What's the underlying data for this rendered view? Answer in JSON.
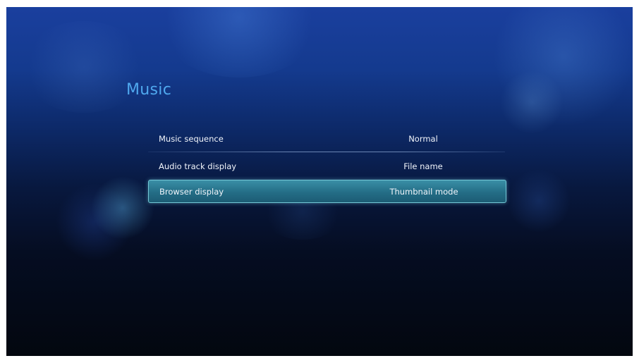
{
  "page": {
    "title": "Music"
  },
  "settings": [
    {
      "label": "Music sequence",
      "value": "Normal"
    },
    {
      "label": "Audio track display",
      "value": "File name"
    },
    {
      "label": "Browser display",
      "value": "Thumbnail mode"
    }
  ],
  "selected_index": 2,
  "colors": {
    "title": "#4fa8ee",
    "highlight": "#2f8099",
    "highlight_border": "#74c7d6",
    "text": "#f0f4fa"
  }
}
